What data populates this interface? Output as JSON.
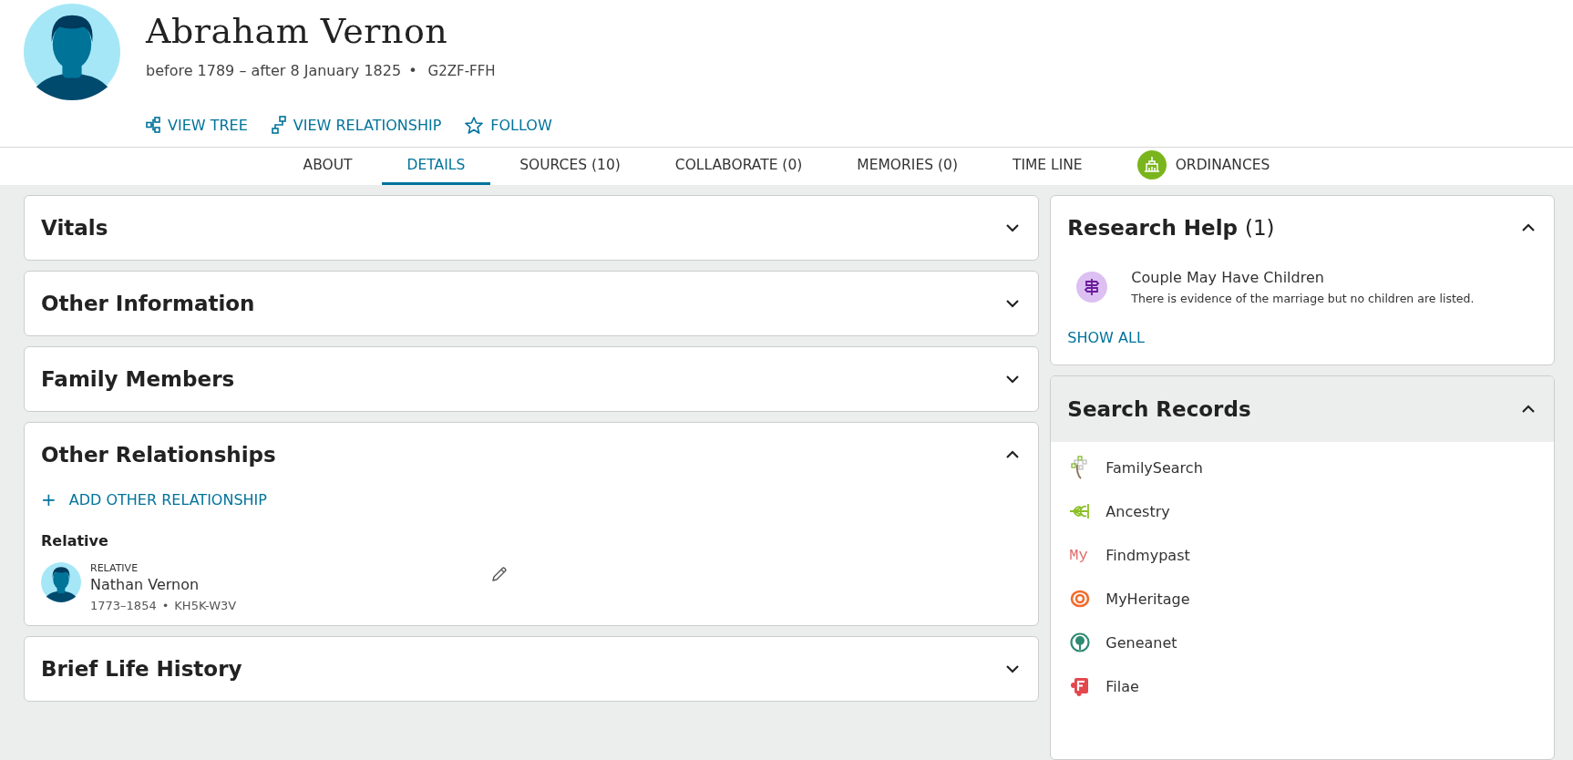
{
  "person": {
    "name": "Abraham Vernon",
    "lifespan": "before 1789 – after 8 January 1825",
    "separator": "•",
    "id": "G2ZF-FFH"
  },
  "actions": [
    {
      "kind": "tree",
      "label": "VIEW TREE"
    },
    {
      "kind": "relationship",
      "label": "VIEW RELATIONSHIP"
    },
    {
      "kind": "follow",
      "label": "FOLLOW"
    }
  ],
  "tabs": [
    {
      "label": "ABOUT",
      "selected": false
    },
    {
      "label": "DETAILS",
      "selected": true
    },
    {
      "label": "SOURCES (10)",
      "selected": false
    },
    {
      "label": "COLLABORATE (0)",
      "selected": false
    },
    {
      "label": "MEMORIES (0)",
      "selected": false
    },
    {
      "label": "TIME LINE",
      "selected": false
    },
    {
      "label": "ORDINANCES",
      "selected": false,
      "kind": "ordinances"
    }
  ],
  "left_sections": [
    {
      "title": "Vitals",
      "expanded": false
    },
    {
      "title": "Other Information",
      "expanded": false
    },
    {
      "title": "Family Members",
      "expanded": false
    },
    {
      "title": "Other Relationships",
      "expanded": true,
      "add_icon": "+",
      "add_label": "ADD OTHER RELATIONSHIP",
      "group_heading": "Relative",
      "people": [
        {
          "role": "RELATIVE",
          "name": "Nathan Vernon",
          "lifespan": "1773–1854",
          "separator": "•",
          "id": "KH5K-W3V"
        }
      ]
    },
    {
      "title": "Brief Life History",
      "expanded": false
    }
  ],
  "research_help": {
    "title": "Research Help",
    "count": "(1)",
    "expanded": true,
    "items": [
      {
        "title": "Couple May Have Children",
        "description": "There is evidence of the marriage but no children are listed."
      }
    ],
    "show_all": "SHOW ALL"
  },
  "search_records": {
    "title": "Search Records",
    "expanded": true,
    "items": [
      {
        "kind": "familysearch",
        "label": "FamilySearch"
      },
      {
        "kind": "ancestry",
        "label": "Ancestry"
      },
      {
        "kind": "findmypast",
        "label": "Findmypast",
        "logo_text": "My"
      },
      {
        "kind": "myheritage",
        "label": "MyHeritage"
      },
      {
        "kind": "geneanet",
        "label": "Geneanet"
      },
      {
        "kind": "filae",
        "label": "Filae"
      }
    ]
  }
}
